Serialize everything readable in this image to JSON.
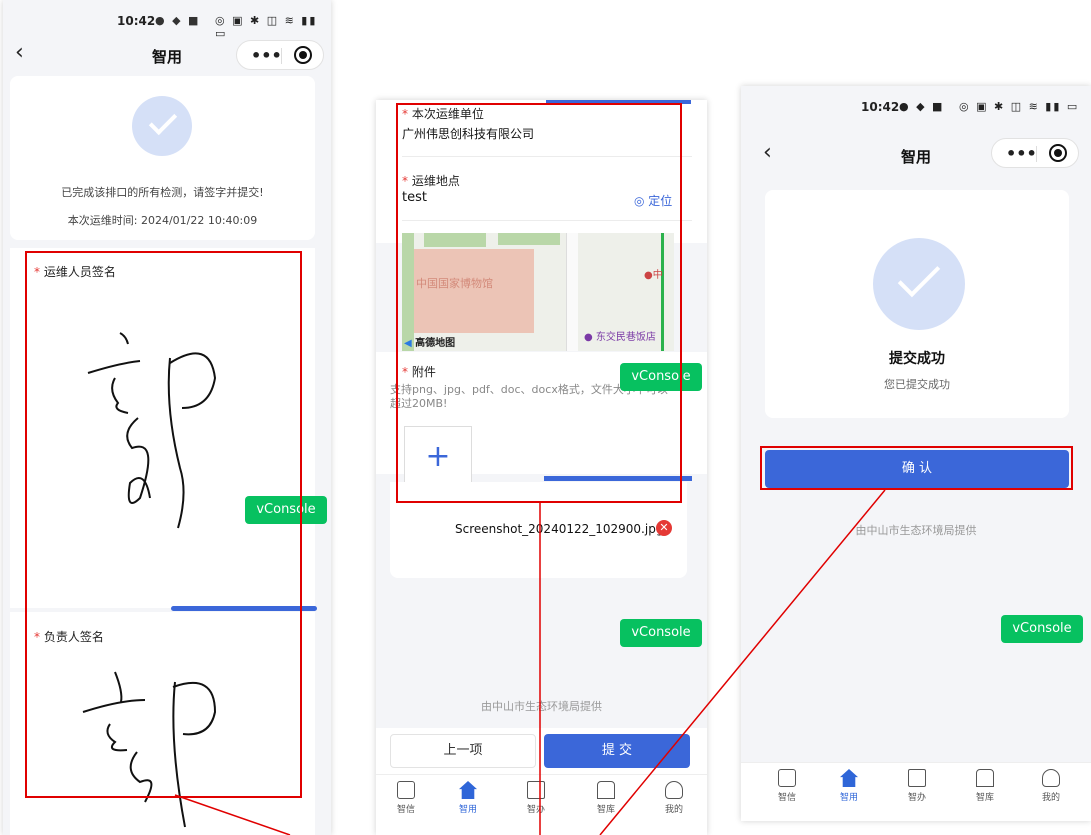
{
  "app_title": "智用",
  "status_time": "10:42",
  "vconsole": "vConsole",
  "screen1": {
    "success_text": "已完成该排口的所有检测，请签字并提交!",
    "time_label": "本次运维时间:",
    "time_value": "2024/01/22 10:40:09",
    "sign_label": "运维人员签名",
    "leader_sign_label": "负责人签名"
  },
  "screen2": {
    "unit_label": "本次运维单位",
    "unit_value": "广州伟思创科技有限公司",
    "location_label": "运维地点",
    "location_value": "test",
    "locate_btn": "定位",
    "map_poi_1": "中国国家博物馆",
    "map_poi_2": "东交民巷饭店",
    "map_poi_3": "中",
    "map_logo": "高德地图",
    "attach_label": "附件",
    "attach_hint": "支持png、jpg、pdf、doc、docx格式，文件大小不可以超过20MB!",
    "file_name": "Screenshot_20240122_102900.jpg",
    "footer": "由中山市生态环境局提供",
    "prev_btn": "上一项",
    "submit_btn": "提 交"
  },
  "screen3": {
    "success_title": "提交成功",
    "success_sub": "您已提交成功",
    "confirm_btn": "确 认",
    "footer": "由中山市生态环境局提供"
  },
  "tabbar": [
    {
      "label": "智信",
      "icon": "chat-icon"
    },
    {
      "label": "智用",
      "icon": "home-icon"
    },
    {
      "label": "智办",
      "icon": "task-icon"
    },
    {
      "label": "智库",
      "icon": "library-icon"
    },
    {
      "label": "我的",
      "icon": "user-icon"
    }
  ],
  "colors": {
    "accent": "#3b67d9",
    "required": "#e53935",
    "vconsole": "#07c160",
    "annotation": "#e00000"
  }
}
